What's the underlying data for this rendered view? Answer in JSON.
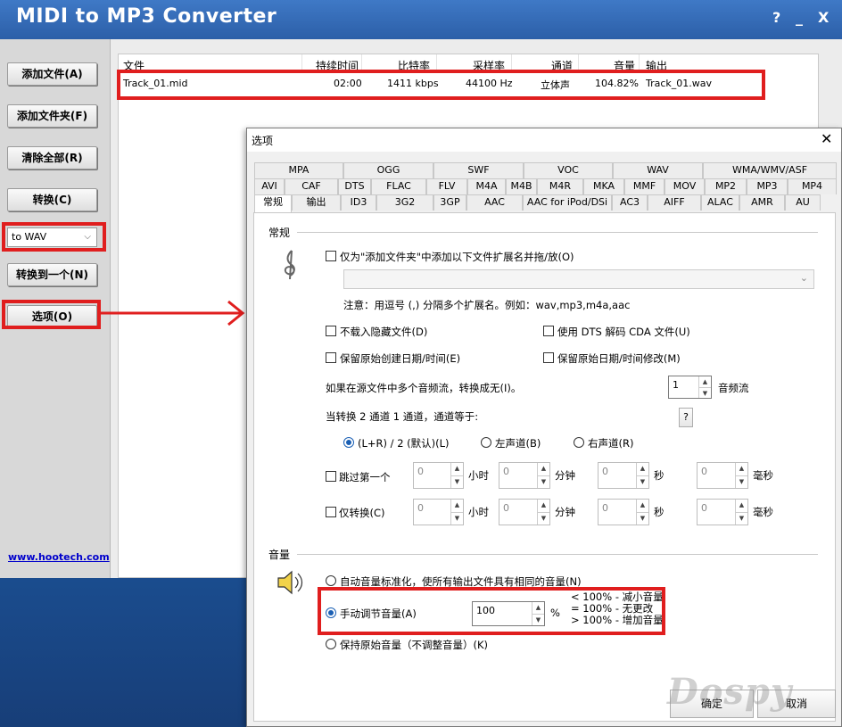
{
  "window": {
    "title": "MIDI to MP3 Converter",
    "help_label": "?",
    "minimize_label": "_",
    "close_label": "X"
  },
  "sidebar": {
    "add_files": "添加文件(A)",
    "add_folder": "添加文件夹(F)",
    "clear_all": "清除全部(R)",
    "convert": "转换(C)",
    "output_format": "to WAV",
    "convert_to_one": "转换到一个(N)",
    "options": "选项(O)",
    "website": "www.hootech.com"
  },
  "file_table": {
    "headers": [
      "文件",
      "持续时间",
      "比特率",
      "采样率",
      "通道",
      "音量",
      "输出"
    ],
    "rows": [
      {
        "file": "Track_01.mid",
        "duration": "02:00",
        "bitrate": "1411 kbps",
        "samplerate": "44100 Hz",
        "channels": "立体声",
        "volume": "104.82%",
        "output": "Track_01.wav"
      }
    ]
  },
  "dialog": {
    "title": "选项",
    "close_label": "✕",
    "tabs_row1": [
      "MPA",
      "OGG",
      "SWF",
      "VOC",
      "WAV",
      "WMA/WMV/ASF"
    ],
    "tabs_row2": [
      "AVI",
      "CAF",
      "DTS",
      "FLAC",
      "FLV",
      "M4A",
      "M4B",
      "M4R",
      "MKA",
      "MMF",
      "MOV",
      "MP2",
      "MP3",
      "MP4"
    ],
    "tabs_row3": [
      "常规",
      "输出",
      "ID3",
      "3G2",
      "3GP",
      "AAC",
      "AAC for iPod/DSi",
      "AC3",
      "AIFF",
      "ALAC",
      "AMR",
      "AU"
    ],
    "general": {
      "section_title": "常规",
      "only_add_ext": "仅为\"添加文件夹\"中添加以下文件扩展名并拖/放(O)",
      "ext_note": "注意：用逗号 (,) 分隔多个扩展名。例如：wav,mp3,m4a,aac",
      "no_hidden": "不载入隐藏文件(D)",
      "use_dts": "使用 DTS 解码 CDA 文件(U)",
      "keep_created": "保留原始创建日期/时间(E)",
      "keep_modified": "保留原始日期/时间修改(M)",
      "multi_stream": "如果在源文件中多个音频流，转换成无(I)。",
      "stream_count": "1",
      "stream_unit": "音频流",
      "two_to_one": "当转换 2 通道 1 通道，通道等于:",
      "help_btn": "?",
      "ch_lr": "(L+R) / 2 (默认)(L)",
      "ch_left": "左声道(B)",
      "ch_right": "右声道(R)",
      "skip_first": "跳过第一个",
      "only_convert": "仅转换(C)",
      "zero": "0",
      "hours": "小时",
      "minutes": "分钟",
      "seconds": "秒",
      "ms": "毫秒"
    },
    "volume": {
      "section_title": "音量",
      "auto_normalize": "自动音量标准化，使所有输出文件具有相同的音量(N)",
      "manual": "手动调节音量(A)",
      "manual_value": "100",
      "percent": "%",
      "hint_less": "< 100% - 减小音量",
      "hint_equal": "= 100% - 无更改",
      "hint_more": "> 100% - 增加音量",
      "keep_original": "保持原始音量（不调整音量）(K)"
    },
    "ok": "确定",
    "cancel": "取消"
  },
  "watermark": "Dospy"
}
